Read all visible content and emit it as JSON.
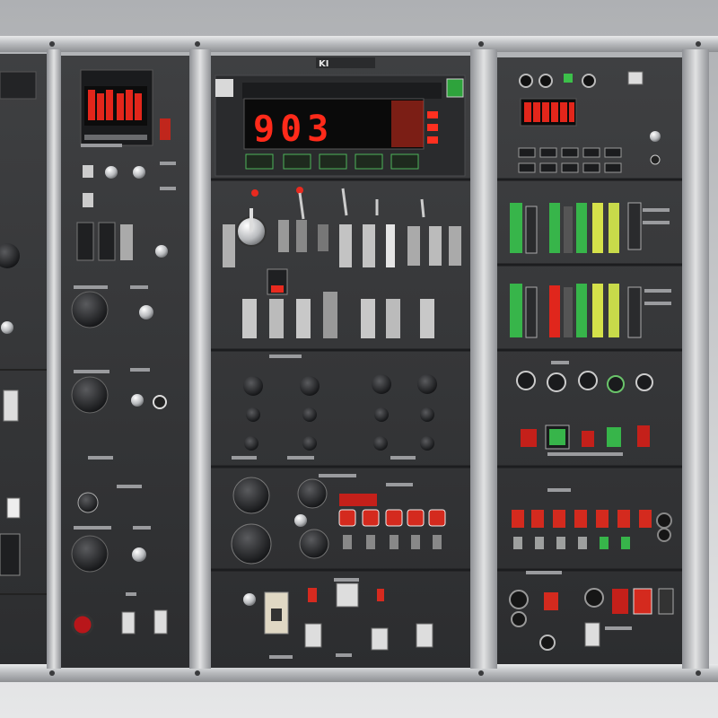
{
  "main_display": {
    "value": "903"
  },
  "brand_badge": {
    "text": "KI"
  },
  "colors": {
    "led_red": "#ff2a1a",
    "led_green": "#33d04a",
    "led_yellow": "#c8e04a",
    "panel": "#3a3b3d",
    "frame": "#b9bbbe"
  }
}
